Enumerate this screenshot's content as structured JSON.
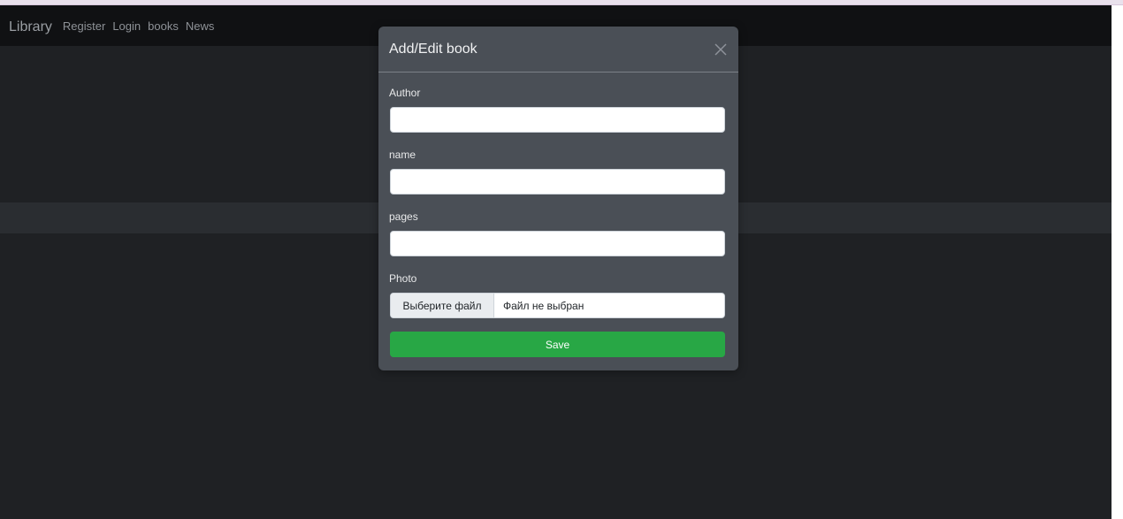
{
  "navbar": {
    "brand": "Library",
    "links": [
      "Register",
      "Login",
      "books",
      "News"
    ]
  },
  "modal": {
    "title": "Add/Edit book",
    "close_icon": "close-icon",
    "fields": [
      {
        "label": "Author",
        "value": "",
        "placeholder": ""
      },
      {
        "label": "name",
        "value": "",
        "placeholder": ""
      },
      {
        "label": "pages",
        "value": "",
        "placeholder": ""
      }
    ],
    "photo": {
      "label": "Photo",
      "button_label": "Выберите файл",
      "status": "Файл не выбран"
    },
    "save_label": "Save"
  },
  "colors": {
    "navbar_bg": "#101113",
    "page_bg": "#1f2124",
    "modal_bg": "#4a4f56",
    "save_button": "#28a745"
  }
}
